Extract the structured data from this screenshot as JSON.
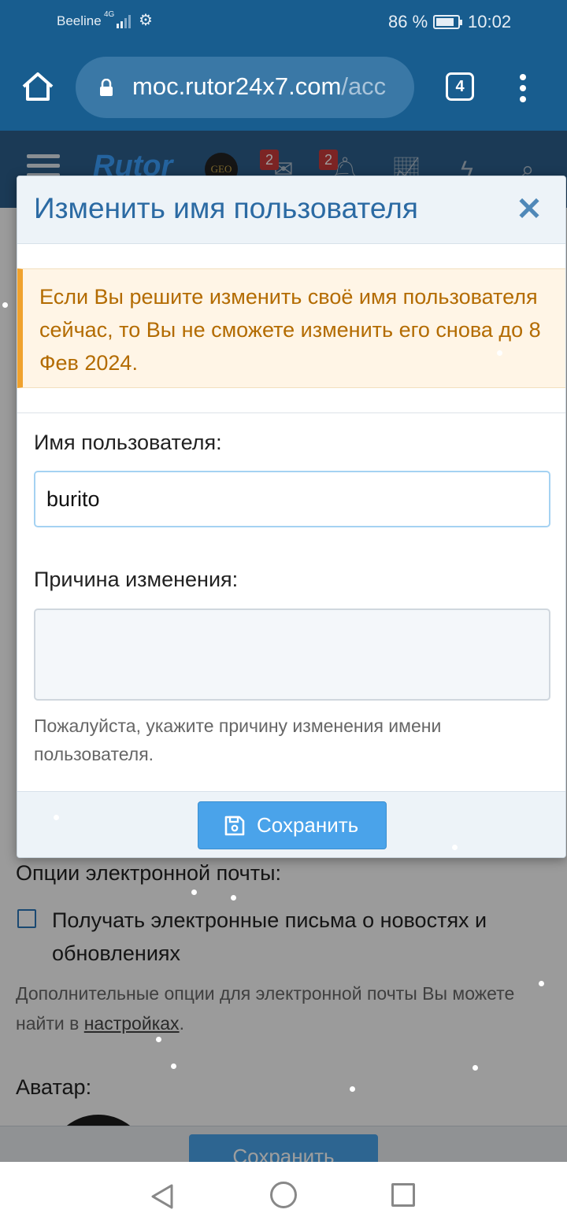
{
  "status_bar": {
    "carrier": "Beeline",
    "network": "4G",
    "battery_percent": "86 %",
    "battery_level": 0.86,
    "time": "10:02"
  },
  "browser": {
    "url_domain": "moc.rutor24x7.com",
    "url_path": "/acc",
    "tab_count": "4"
  },
  "site_header": {
    "logo_text": "Rutor",
    "geo_badge": "GEO",
    "messages_badge": "2",
    "alerts_badge": "2"
  },
  "background_page": {
    "email_options_label": "Опции электронной почты:",
    "newsletter_checkbox_label": "Получать электронные письма о новостях и обновлениях",
    "newsletter_checked": false,
    "email_hint_prefix": "Дополнительные опции для электронной почты Вы можете найти в ",
    "email_hint_link": "настройках",
    "email_hint_suffix": ".",
    "avatar_label": "Аватар:",
    "save_label": "Сохранить"
  },
  "modal": {
    "title": "Изменить имя пользователя",
    "close_symbol": "✕",
    "warning_text": "Если Вы решите изменить своё имя пользователя сейчас, то Вы не сможете изменить его снова до 8 Фев 2024.",
    "username_label": "Имя пользователя:",
    "username_value": "burito",
    "reason_label": "Причина изменения:",
    "reason_value": "",
    "reason_help": "Пожалуйста, укажите причину изменения имени пользователя.",
    "save_label": "Сохранить"
  },
  "icons": {
    "home": "home-icon",
    "lock": "lock-icon",
    "tabs": "tabs-icon",
    "menu": "more-vert-icon",
    "save": "floppy-disk-icon",
    "close": "close-icon"
  },
  "colors": {
    "browser_bar": "#185d8f",
    "site_header": "#2d5e8c",
    "accent": "#2b6aa3",
    "button": "#4aa3ea",
    "warning_text": "#b36b00",
    "warning_bg": "#fff5e6",
    "warning_border": "#f0a22d"
  }
}
